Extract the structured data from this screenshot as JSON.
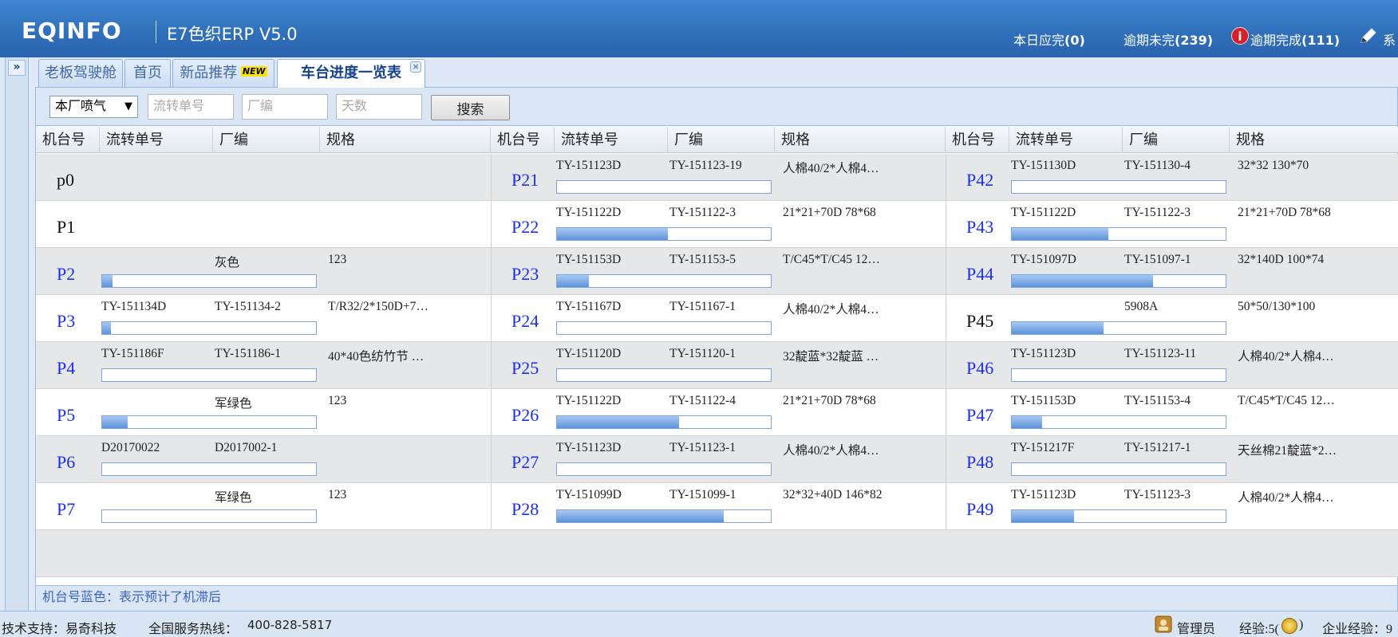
{
  "header": {
    "logo": "EQINFO",
    "app_title": "E7色织ERP V5.0",
    "stats": [
      {
        "label": "本日应完",
        "count": "(0)"
      },
      {
        "label": "逾期未完",
        "count": "(239)"
      },
      {
        "label": "逾期完成",
        "count": "(111)"
      },
      {
        "label": "系"
      }
    ]
  },
  "sidebar": {
    "expand_label": "»"
  },
  "tabs": [
    {
      "label": "老板驾驶舱"
    },
    {
      "label": "首页"
    },
    {
      "label": "新品推荐",
      "badge": "NEW"
    },
    {
      "label": "车台进度一览表",
      "close": "×"
    }
  ],
  "toolbar": {
    "select_value": "本厂喷气",
    "select_arrow": "▼",
    "flow_placeholder": "流转单号",
    "factory_placeholder": "厂编",
    "days_placeholder": "天数",
    "search_label": "搜索"
  },
  "columns": [
    "机台号",
    "流转单号",
    "厂编",
    "规格"
  ],
  "groups": [
    [
      {
        "machine": "p0",
        "flow": "",
        "code": "",
        "spec": "",
        "progress": null,
        "delayed": false
      },
      {
        "machine": "P1",
        "flow": "",
        "code": "",
        "spec": "",
        "progress": null,
        "delayed": false
      },
      {
        "machine": "P2",
        "flow": "",
        "code": "灰色",
        "spec": "123",
        "progress": 0.05,
        "delayed": true
      },
      {
        "machine": "P3",
        "flow": "TY-151134D",
        "code": "TY-151134-2",
        "spec": "T/R32/2*150D+7…",
        "progress": 0.04,
        "delayed": true
      },
      {
        "machine": "P4",
        "flow": "TY-151186F",
        "code": "TY-151186-1",
        "spec": "40*40色纺竹节 …",
        "progress": 0,
        "delayed": true
      },
      {
        "machine": "P5",
        "flow": "",
        "code": "军绿色",
        "spec": "123",
        "progress": 0.12,
        "delayed": true
      },
      {
        "machine": "P6",
        "flow": "D20170022",
        "code": "D2017002-1",
        "spec": "",
        "progress": 0,
        "delayed": true
      },
      {
        "machine": "P7",
        "flow": "",
        "code": "军绿色",
        "spec": "123",
        "progress": 0,
        "delayed": true
      }
    ],
    [
      {
        "machine": "P21",
        "flow": "TY-151123D",
        "code": "TY-151123-19",
        "spec": "人棉40/2*人棉4…",
        "progress": 0,
        "delayed": true
      },
      {
        "machine": "P22",
        "flow": "TY-151122D",
        "code": "TY-151122-3",
        "spec": "21*21+70D 78*68",
        "progress": 0.52,
        "delayed": true
      },
      {
        "machine": "P23",
        "flow": "TY-151153D",
        "code": "TY-151153-5",
        "spec": "T/C45*T/C45 12…",
        "progress": 0.15,
        "delayed": true
      },
      {
        "machine": "P24",
        "flow": "TY-151167D",
        "code": "TY-151167-1",
        "spec": "人棉40/2*人棉4…",
        "progress": 0,
        "delayed": true
      },
      {
        "machine": "P25",
        "flow": "TY-151120D",
        "code": "TY-151120-1",
        "spec": "32靛蓝*32靛蓝 …",
        "progress": 0,
        "delayed": true
      },
      {
        "machine": "P26",
        "flow": "TY-151122D",
        "code": "TY-151122-4",
        "spec": "21*21+70D 78*68",
        "progress": 0.57,
        "delayed": true
      },
      {
        "machine": "P27",
        "flow": "TY-151123D",
        "code": "TY-151123-1",
        "spec": "人棉40/2*人棉4…",
        "progress": 0,
        "delayed": true
      },
      {
        "machine": "P28",
        "flow": "TY-151099D",
        "code": "TY-151099-1",
        "spec": "32*32+40D 146*82",
        "progress": 0.78,
        "delayed": true
      }
    ],
    [
      {
        "machine": "P42",
        "flow": "TY-151130D",
        "code": "TY-151130-4",
        "spec": "32*32 130*70",
        "progress": 0,
        "delayed": true
      },
      {
        "machine": "P43",
        "flow": "TY-151122D",
        "code": "TY-151122-3",
        "spec": "21*21+70D 78*68",
        "progress": 0.45,
        "delayed": true
      },
      {
        "machine": "P44",
        "flow": "TY-151097D",
        "code": "TY-151097-1",
        "spec": "32*140D 100*74",
        "progress": 0.66,
        "delayed": true
      },
      {
        "machine": "P45",
        "flow": "",
        "code": "5908A",
        "spec": "50*50/130*100",
        "progress": 0.43,
        "delayed": false
      },
      {
        "machine": "P46",
        "flow": "TY-151123D",
        "code": "TY-151123-11",
        "spec": "人棉40/2*人棉4…",
        "progress": 0,
        "delayed": true
      },
      {
        "machine": "P47",
        "flow": "TY-151153D",
        "code": "TY-151153-4",
        "spec": "T/C45*T/C45 12…",
        "progress": 0.14,
        "delayed": true
      },
      {
        "machine": "P48",
        "flow": "TY-151217F",
        "code": "TY-151217-1",
        "spec": "天丝棉21靛蓝*2…",
        "progress": 0,
        "delayed": true
      },
      {
        "machine": "P49",
        "flow": "TY-151123D",
        "code": "TY-151123-3",
        "spec": "人棉40/2*人棉4…",
        "progress": 0.29,
        "delayed": true
      }
    ]
  ],
  "legend_note": "机台号蓝色：表示预计了机滞后",
  "footer": {
    "support": "技术支持：易奇科技",
    "hotline_label": "全国服务热线：",
    "hotline": "400-828-5817",
    "user": "管理员",
    "exp_label": "经验:5(",
    "exp_close": ")",
    "company_exp": "企业经验：9"
  },
  "colors": {
    "delayed_machine": "#1b2ef2",
    "normal_machine": "#111111",
    "header_bg": "#2f6fba"
  }
}
